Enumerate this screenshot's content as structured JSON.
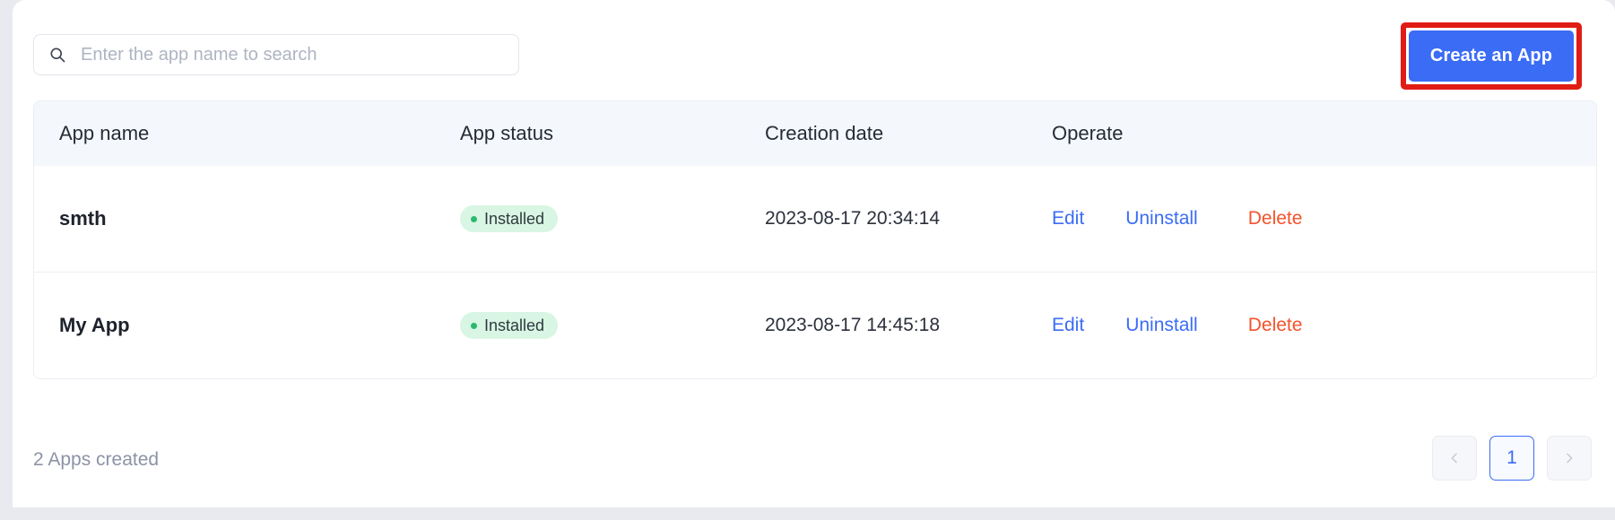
{
  "toolbar": {
    "search_placeholder": "Enter the app name to search",
    "search_value": "",
    "search_icon": "search-icon",
    "create_label": "Create an App"
  },
  "table": {
    "columns": [
      "App name",
      "App status",
      "Creation date",
      "Operate"
    ],
    "rows": [
      {
        "name": "smth",
        "status": "Installed",
        "date": "2023-08-17 20:34:14",
        "actions": [
          "Edit",
          "Uninstall",
          "Delete"
        ]
      },
      {
        "name": "My App",
        "status": "Installed",
        "date": "2023-08-17 14:45:18",
        "actions": [
          "Edit",
          "Uninstall",
          "Delete"
        ]
      }
    ]
  },
  "footer": {
    "count_text": "2 Apps created",
    "pagination": {
      "prev_icon": "chevron-left-icon",
      "next_icon": "chevron-right-icon",
      "current_page": "1"
    }
  },
  "colors": {
    "primary_blue": "#3b6cf6",
    "danger_red": "#f4532a",
    "highlight_red": "#e11c14",
    "badge_green_bg": "#d8f6e3",
    "badge_green_dot": "#2cb96f",
    "header_bg": "#f4f7fb",
    "page_bg": "#e8eaef"
  }
}
